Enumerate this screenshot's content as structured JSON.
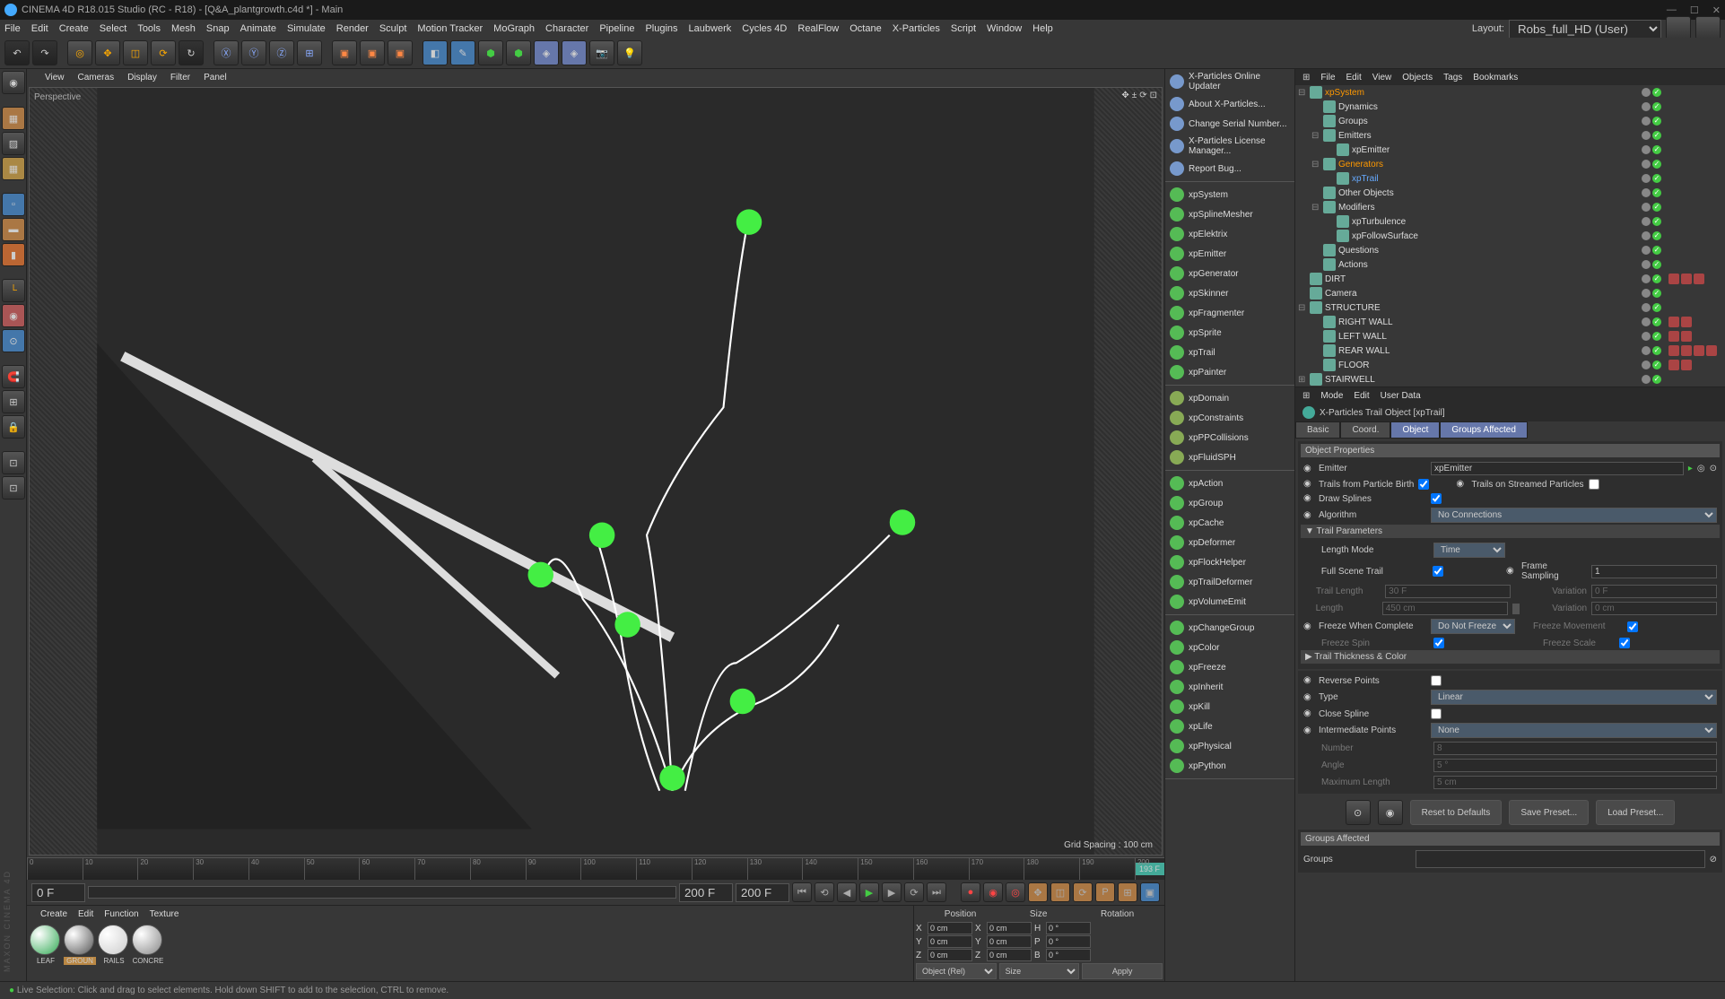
{
  "titlebar": "CINEMA 4D R18.015 Studio (RC - R18) - [Q&A_plantgrowth.c4d *] - Main",
  "menubar": [
    "File",
    "Edit",
    "Create",
    "Select",
    "Tools",
    "Mesh",
    "Snap",
    "Animate",
    "Simulate",
    "Render",
    "Sculpt",
    "Motion Tracker",
    "MoGraph",
    "Character",
    "Pipeline",
    "Plugins",
    "Laubwerk",
    "Cycles 4D",
    "RealFlow",
    "Octane",
    "X-Particles",
    "Script",
    "Window",
    "Help"
  ],
  "layout_label": "Layout:",
  "layout_value": "Robs_full_HD (User)",
  "viewport_menu": [
    "View",
    "Cameras",
    "Display",
    "Filter",
    "Panel"
  ],
  "viewport_label": "Perspective",
  "grid_spacing": "Grid Spacing : 100 cm",
  "timeline_current": "193 F",
  "playback": {
    "start": "0 F",
    "end": "200 F",
    "end2": "200 F"
  },
  "materials_menu": [
    "Create",
    "Edit",
    "Function",
    "Texture"
  ],
  "materials": [
    "LEAF",
    "GROUN",
    "RAILS",
    "CONCRE"
  ],
  "coords": {
    "headers": [
      "Position",
      "Size",
      "Rotation"
    ],
    "labels": [
      "X",
      "Y",
      "Z"
    ],
    "px": "0 cm",
    "py": "0 cm",
    "pz": "0 cm",
    "sx": "0 cm",
    "sy": "0 cm",
    "sz": "0 cm",
    "rh": "0 °",
    "rp": "0 °",
    "rb": "0 °",
    "object_sel": "Object (Rel)",
    "size_sel": "Size",
    "apply": "Apply"
  },
  "xp_top": [
    "X-Particles Online Updater",
    "About X-Particles...",
    "Change Serial Number...",
    "X-Particles License Manager...",
    "Report Bug..."
  ],
  "xp_gen": [
    "xpSystem",
    "xpSplineMesher",
    "xpElektrix",
    "xpEmitter",
    "xpGenerator",
    "xpSkinner",
    "xpFragmenter",
    "xpSprite",
    "xpTrail",
    "xpPainter"
  ],
  "xp_obj": [
    "xpDomain",
    "xpConstraints",
    "xpPPCollisions",
    "xpFluidSPH"
  ],
  "xp_act": [
    "xpAction",
    "xpGroup",
    "xpCache",
    "xpDeformer",
    "xpFlockHelper",
    "xpTrailDeformer",
    "xpVolumeEmit"
  ],
  "xp_grp": [
    "xpChangeGroup",
    "xpColor",
    "xpFreeze",
    "xpInherit",
    "xpKill",
    "xpLife",
    "xpPhysical",
    "xpPython"
  ],
  "obj_menu": [
    "File",
    "Edit",
    "View",
    "Objects",
    "Tags",
    "Bookmarks"
  ],
  "obj_tree": [
    {
      "d": 0,
      "label": "xpSystem",
      "cls": "orange",
      "exp": "-"
    },
    {
      "d": 1,
      "label": "Dynamics",
      "exp": ""
    },
    {
      "d": 1,
      "label": "Groups",
      "exp": ""
    },
    {
      "d": 1,
      "label": "Emitters",
      "exp": "-"
    },
    {
      "d": 2,
      "label": "xpEmitter",
      "exp": ""
    },
    {
      "d": 1,
      "label": "Generators",
      "cls": "orange",
      "exp": "-"
    },
    {
      "d": 2,
      "label": "xpTrail",
      "cls": "blue",
      "exp": ""
    },
    {
      "d": 1,
      "label": "Other Objects",
      "exp": ""
    },
    {
      "d": 1,
      "label": "Modifiers",
      "exp": "-"
    },
    {
      "d": 2,
      "label": "xpTurbulence",
      "exp": ""
    },
    {
      "d": 2,
      "label": "xpFollowSurface",
      "exp": ""
    },
    {
      "d": 1,
      "label": "Questions",
      "exp": ""
    },
    {
      "d": 1,
      "label": "Actions",
      "exp": ""
    },
    {
      "d": 0,
      "label": "DIRT",
      "exp": "",
      "tags": 3
    },
    {
      "d": 0,
      "label": "Camera",
      "exp": ""
    },
    {
      "d": 0,
      "label": "STRUCTURE",
      "exp": "-"
    },
    {
      "d": 1,
      "label": "RIGHT WALL",
      "exp": "",
      "tags": 2
    },
    {
      "d": 1,
      "label": "LEFT WALL",
      "exp": "",
      "tags": 2
    },
    {
      "d": 1,
      "label": "REAR WALL",
      "exp": "",
      "tags": 4
    },
    {
      "d": 1,
      "label": "FLOOR",
      "exp": "",
      "tags": 2
    },
    {
      "d": 0,
      "label": "STAIRWELL",
      "exp": "+"
    }
  ],
  "attr_menu": [
    "Mode",
    "Edit",
    "User Data"
  ],
  "attr_title": "X-Particles Trail Object [xpTrail]",
  "attr_tabs": [
    "Basic",
    "Coord.",
    "Object",
    "Groups Affected"
  ],
  "obj_props": {
    "header": "Object Properties",
    "emitter_label": "Emitter",
    "emitter_value": "xpEmitter",
    "trails_birth": "Trails from Particle Birth",
    "trails_stream": "Trails on Streamed Particles",
    "draw_splines": "Draw Splines",
    "algorithm_label": "Algorithm",
    "algorithm_value": "No Connections",
    "trail_params": "Trail Parameters",
    "length_mode_label": "Length Mode",
    "length_mode_value": "Time",
    "full_scene": "Full Scene Trail",
    "frame_sampling": "Frame Sampling",
    "frame_sampling_val": "1",
    "trail_length": "Trail Length",
    "trail_length_val": "30 F",
    "variation": "Variation",
    "variation_val": "0 F",
    "length": "Length",
    "length_val": "450 cm",
    "variation2_val": "0 cm",
    "freeze_complete": "Freeze When Complete",
    "freeze_val": "Do Not Freeze",
    "freeze_movement": "Freeze Movement",
    "freeze_spin": "Freeze Spin",
    "freeze_scale": "Freeze Scale",
    "thickness": "Trail Thickness & Color",
    "reverse": "Reverse Points",
    "type_label": "Type",
    "type_value": "Linear",
    "close_spline": "Close Spline",
    "interp_label": "Intermediate Points",
    "interp_value": "None",
    "number": "Number",
    "number_val": "8",
    "angle": "Angle",
    "angle_val": "5 °",
    "max_length": "Maximum Length",
    "max_length_val": "5 cm"
  },
  "attr_buttons": {
    "reset": "Reset to Defaults",
    "save": "Save Preset...",
    "load": "Load Preset..."
  },
  "groups_affected": "Groups Affected",
  "groups_label": "Groups",
  "statusbar": "Live Selection: Click and drag to select elements. Hold down SHIFT to add to the selection, CTRL to remove."
}
